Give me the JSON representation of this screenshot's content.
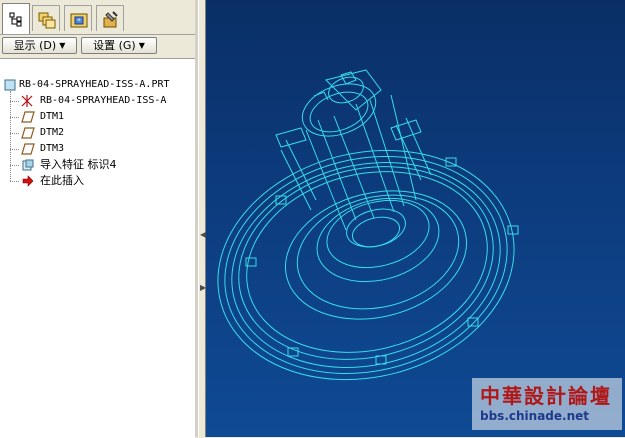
{
  "toolbar": {
    "display_label": "显示 (D)",
    "settings_label": "设置 (G)"
  },
  "tabs": [
    {
      "icon": "model-tree-icon"
    },
    {
      "icon": "folder-browser-icon"
    },
    {
      "icon": "favorites-icon"
    },
    {
      "icon": "tools-icon"
    }
  ],
  "tree": {
    "root": "RB-04-SPRAYHEAD-ISS-A.PRT",
    "items": [
      {
        "label": "RB-04-SPRAYHEAD-ISS-A",
        "icon": "coordinate-system-icon"
      },
      {
        "label": "DTM1",
        "icon": "datum-plane-icon"
      },
      {
        "label": "DTM2",
        "icon": "datum-plane-icon"
      },
      {
        "label": "DTM3",
        "icon": "datum-plane-icon"
      },
      {
        "label": "导入特征 标识4",
        "icon": "import-feature-icon"
      },
      {
        "label": "在此插入",
        "icon": "insert-here-arrow-icon"
      }
    ]
  },
  "watermark": {
    "title": "中華設計論壇",
    "url": "bbs.chinade.net"
  },
  "colors": {
    "viewport_bg": "#0d3d80",
    "wireframe": "#39e5f0",
    "insert_arrow": "#d41010",
    "watermark_title": "#b01818"
  }
}
